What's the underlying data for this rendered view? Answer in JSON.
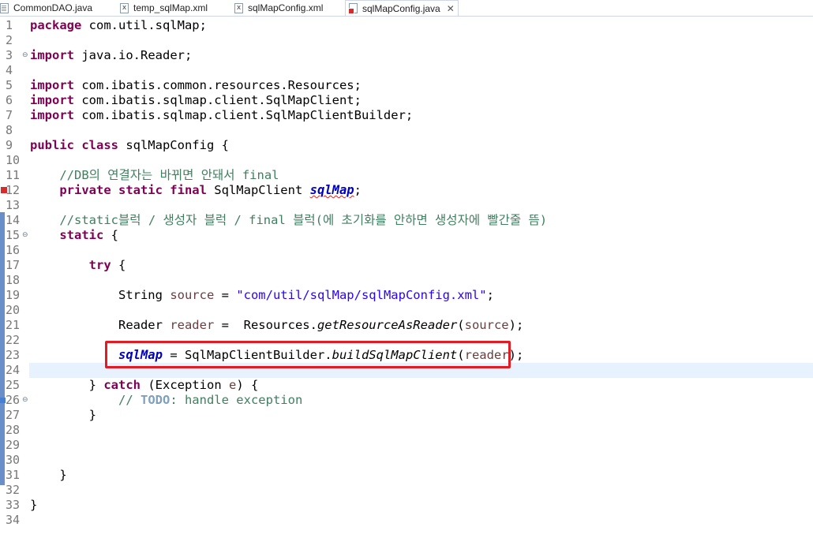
{
  "tabs": [
    {
      "label": "CommonDAO.java",
      "icon": "java-file-icon"
    },
    {
      "label": "temp_sqlMap.xml",
      "icon": "xml-file-icon"
    },
    {
      "label": "sqlMapConfig.xml",
      "icon": "xml-file-icon"
    },
    {
      "label": "sqlMapConfig.java",
      "icon": "java-error-file-icon",
      "active": true,
      "close": "✕"
    }
  ],
  "lines": [
    {
      "n": "1"
    },
    {
      "n": "2"
    },
    {
      "n": "3"
    },
    {
      "n": "4"
    },
    {
      "n": "5"
    },
    {
      "n": "6"
    },
    {
      "n": "7"
    },
    {
      "n": "8"
    },
    {
      "n": "9"
    },
    {
      "n": "10"
    },
    {
      "n": "11"
    },
    {
      "n": "12"
    },
    {
      "n": "13"
    },
    {
      "n": "14"
    },
    {
      "n": "15"
    },
    {
      "n": "16"
    },
    {
      "n": "17"
    },
    {
      "n": "18"
    },
    {
      "n": "19"
    },
    {
      "n": "20"
    },
    {
      "n": "21"
    },
    {
      "n": "22"
    },
    {
      "n": "23"
    },
    {
      "n": "24"
    },
    {
      "n": "25"
    },
    {
      "n": "26"
    },
    {
      "n": "27"
    },
    {
      "n": "28"
    },
    {
      "n": "29"
    },
    {
      "n": "30"
    },
    {
      "n": "31"
    },
    {
      "n": "32"
    },
    {
      "n": "33"
    },
    {
      "n": "34"
    }
  ],
  "code": {
    "l1_kw": "package",
    "l1_rest": " com.util.sqlMap;",
    "l3_kw": "import",
    "l3_rest": " java.io.Reader;",
    "l5_kw": "import",
    "l5_rest": " com.ibatis.common.resources.Resources;",
    "l6_kw": "import",
    "l6_rest": " com.ibatis.sqlmap.client.SqlMapClient;",
    "l7_kw": "import",
    "l7_rest": " com.ibatis.sqlmap.client.SqlMapClientBuilder;",
    "l9_kw": "public class",
    "l9_rest": " sqlMapConfig {",
    "l11_indent": "    ",
    "l11_cm": "//DB의 연결자는 바뀌면 안돼서 final",
    "l12_indent": "    ",
    "l12_kw": "private static final",
    "l12_type": " SqlMapClient ",
    "l12_field": "sqlMap",
    "l12_end": ";",
    "l14_indent": "    ",
    "l14_cm": "//static블럭 / 생성자 블럭 / final 블럭(에 초기화를 안하면 생성자에 빨간줄 뜸)",
    "l15_indent": "    ",
    "l15_kw": "static",
    "l15_rest": " {",
    "l17_indent": "        ",
    "l17_kw": "try",
    "l17_rest": " {",
    "l19_indent": "            ",
    "l19_type": "String ",
    "l19_var": "source",
    "l19_eq": " = ",
    "l19_str": "\"com/util/sqlMap/sqlMapConfig.xml\"",
    "l19_end": ";",
    "l21_indent": "            ",
    "l21_type": "Reader ",
    "l21_var": "reader",
    "l21_eq": " =  Resources.",
    "l21_method": "getResourceAsReader",
    "l21_open": "(",
    "l21_arg": "source",
    "l21_end": ");",
    "l23_indent": "            ",
    "l23_field": "sqlMap",
    "l23_eq": " = SqlMapClientBuilder.",
    "l23_method": "buildSqlMapClient",
    "l23_open": "(",
    "l23_arg": "reader",
    "l23_end": ");",
    "l25_indent": "        ",
    "l25_a": "} ",
    "l25_kw": "catch",
    "l25_b": " (Exception ",
    "l25_var": "e",
    "l25_c": ") {",
    "l26_indent": "            ",
    "l26_cm1": "// ",
    "l26_todo": "TODO",
    "l26_cm2": ": handle exception",
    "l27_indent": "        ",
    "l27_rest": "}",
    "l31_indent": "    ",
    "l31_rest": "}",
    "l33_rest": "}"
  },
  "colors": {
    "keyword": "#7f0055",
    "comment": "#3f7f5f",
    "string": "#2a00ff",
    "field": "#0000c0",
    "highlight_box": "#e31b23",
    "current_line": "#e8f2fe"
  }
}
